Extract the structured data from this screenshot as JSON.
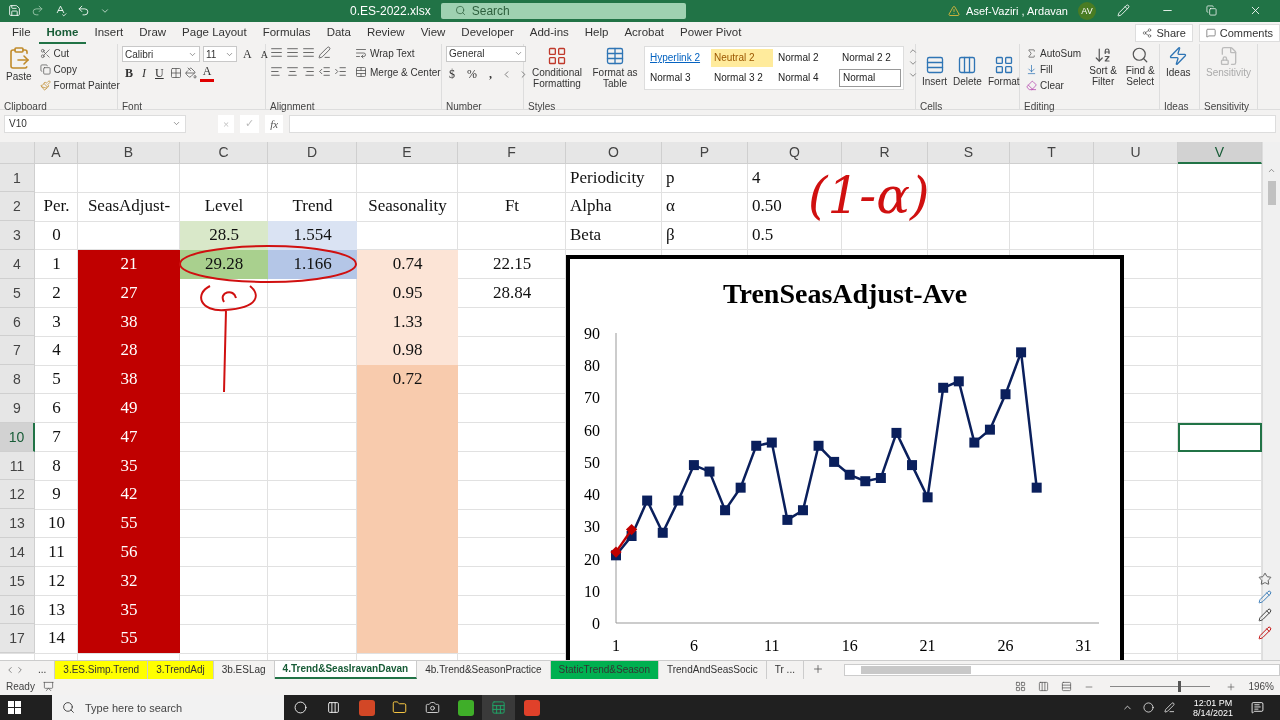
{
  "title_bar": {
    "file_name": "0.ES-2022.xlsx",
    "search": {
      "placeholder": "Search"
    },
    "user": "Asef-Vaziri , Ardavan",
    "avatar": "AV"
  },
  "menu_tabs": [
    {
      "label": "File",
      "selected": false
    },
    {
      "label": "Home",
      "selected": true
    },
    {
      "label": "Insert",
      "selected": false
    },
    {
      "label": "Draw",
      "selected": false
    },
    {
      "label": "Page Layout",
      "selected": false
    },
    {
      "label": "Formulas",
      "selected": false
    },
    {
      "label": "Data",
      "selected": false
    },
    {
      "label": "Review",
      "selected": false
    },
    {
      "label": "View",
      "selected": false
    },
    {
      "label": "Developer",
      "selected": false
    },
    {
      "label": "Add-ins",
      "selected": false
    },
    {
      "label": "Help",
      "selected": false
    },
    {
      "label": "Acrobat",
      "selected": false
    },
    {
      "label": "Power Pivot",
      "selected": false
    }
  ],
  "share": "Share",
  "comments": "Comments",
  "ribbon": [
    {
      "kind": "clipboard",
      "label": "Clipboard",
      "paste": "Paste",
      "cut": "Cut",
      "copy": "Copy",
      "format_painter": "Format Painter"
    },
    {
      "kind": "font",
      "label": "Font",
      "font_name": "Calibri",
      "font_size": "11",
      "grow": "A",
      "shrink": "A",
      "bold": "B",
      "italic": "I",
      "underline": "U",
      "font_color": "A"
    },
    {
      "kind": "alignment",
      "label": "Alignment",
      "wrap_text": "Wrap Text",
      "merge": "Merge & Center"
    },
    {
      "kind": "number",
      "label": "Number",
      "format": "General",
      "currency": "$",
      "percent": "%",
      "comma": ","
    },
    {
      "kind": "styles",
      "label": "Styles",
      "conditional": "Conditional Formatting",
      "format_table": "Format as Table",
      "cell_styles": [
        {
          "label": "Hyperlink 2",
          "kind": "hyperlink",
          "selected": false
        },
        {
          "label": "Neutral 2",
          "kind": "neutral",
          "selected": false
        },
        {
          "label": "Normal 2",
          "kind": "normal",
          "selected": false
        },
        {
          "label": "Normal 2 2",
          "kind": "normal",
          "selected": false
        },
        {
          "label": "Normal 3",
          "kind": "normal",
          "selected": false
        },
        {
          "label": "Normal 3 2",
          "kind": "normal",
          "selected": false
        },
        {
          "label": "Normal 4",
          "kind": "normal",
          "selected": false
        },
        {
          "label": "Normal",
          "kind": "normal",
          "selected": true
        }
      ]
    },
    {
      "kind": "cells",
      "label": "Cells",
      "buttons": [
        "Insert",
        "Delete",
        "Format"
      ]
    },
    {
      "kind": "editing",
      "label": "Editing",
      "autosum": "AutoSum",
      "fill": "Fill",
      "clear": "Clear",
      "sort": "Sort & Filter",
      "find": "Find & Select"
    },
    {
      "kind": "ideas",
      "label": "Ideas",
      "button": "Ideas"
    },
    {
      "kind": "sensitivity",
      "label": "Sensitivity",
      "button": "Sensitivity",
      "disabled": true
    }
  ],
  "formula_bar": {
    "name_box": "V10",
    "cancel": "×",
    "enter": "✓",
    "function": "fx"
  },
  "columns": [
    {
      "label": "A",
      "selected": false
    },
    {
      "label": "B",
      "selected": false
    },
    {
      "label": "C",
      "selected": false
    },
    {
      "label": "D",
      "selected": false
    },
    {
      "label": "E",
      "selected": false
    },
    {
      "label": "F",
      "selected": false
    },
    {
      "label": "O",
      "selected": false
    },
    {
      "label": "P",
      "selected": false
    },
    {
      "label": "Q",
      "selected": false
    },
    {
      "label": "R",
      "selected": false
    },
    {
      "label": "S",
      "selected": false
    },
    {
      "label": "T",
      "selected": false
    },
    {
      "label": "U",
      "selected": false
    },
    {
      "label": "V",
      "selected": true
    }
  ],
  "rows": [
    {
      "header": "1",
      "selected": false,
      "cells": [
        null,
        null,
        null,
        null,
        null,
        null,
        {
          "text": "Periodicity"
        },
        {
          "text": "p"
        },
        {
          "text": "4"
        },
        null,
        null,
        null,
        null,
        null
      ]
    },
    {
      "header": "2",
      "selected": false,
      "cells": [
        {
          "text": "Per."
        },
        {
          "text": "SeasAdjust-"
        },
        {
          "text": "Level"
        },
        {
          "text": "Trend"
        },
        {
          "text": "Seasonality"
        },
        {
          "text": "Ft"
        },
        {
          "text": "Alpha"
        },
        {
          "text": "α"
        },
        {
          "text": "0.50"
        },
        null,
        null,
        null,
        null,
        null
      ]
    },
    {
      "header": "3",
      "selected": false,
      "cells": [
        {
          "text": "0"
        },
        null,
        {
          "text": "28.5",
          "color": "#d9e8c9"
        },
        {
          "text": "1.554",
          "color": "#dae3f3"
        },
        null,
        null,
        {
          "text": "Beta"
        },
        {
          "text": "β"
        },
        {
          "text": "0.5"
        },
        null,
        null,
        null,
        null,
        null
      ]
    },
    {
      "header": "4",
      "selected": false,
      "cells": [
        {
          "text": "1"
        },
        {
          "text": "21",
          "color": "#c00000"
        },
        {
          "text": "29.28",
          "color": "#a9d08e"
        },
        {
          "text": "1.166",
          "color": "#b4c6e7"
        },
        {
          "text": "0.74",
          "color": "#fce4d6"
        },
        {
          "text": "22.15"
        },
        null,
        null,
        null,
        null,
        null,
        null,
        null,
        null
      ]
    },
    {
      "header": "5",
      "selected": false,
      "cells": [
        {
          "text": "2"
        },
        {
          "text": "27",
          "color": "#c00000"
        },
        null,
        null,
        {
          "text": "0.95",
          "color": "#fce4d6"
        },
        {
          "text": "28.84"
        },
        null,
        null,
        null,
        null,
        null,
        null,
        null,
        null
      ]
    },
    {
      "header": "6",
      "selected": false,
      "cells": [
        {
          "text": "3"
        },
        {
          "text": "38",
          "color": "#c00000"
        },
        null,
        null,
        {
          "text": "1.33",
          "color": "#fce4d6"
        },
        null,
        null,
        null,
        null,
        null,
        null,
        null,
        null,
        null
      ]
    },
    {
      "header": "7",
      "selected": false,
      "cells": [
        {
          "text": "4"
        },
        {
          "text": "28",
          "color": "#c00000"
        },
        null,
        null,
        {
          "text": "0.98",
          "color": "#fce4d6"
        },
        null,
        null,
        null,
        null,
        null,
        null,
        null,
        null,
        null
      ]
    },
    {
      "header": "8",
      "selected": false,
      "cells": [
        {
          "text": "5"
        },
        {
          "text": "38",
          "color": "#c00000"
        },
        null,
        null,
        {
          "text": "0.72",
          "color": "#f8cbad"
        },
        null,
        null,
        null,
        null,
        null,
        null,
        null,
        null,
        null
      ]
    },
    {
      "header": "9",
      "selected": false,
      "cells": [
        {
          "text": "6"
        },
        {
          "text": "49",
          "color": "#c00000"
        },
        null,
        null,
        {
          "color": "#f8cbad"
        },
        null,
        null,
        null,
        null,
        null,
        null,
        null,
        null,
        null
      ]
    },
    {
      "header": "10",
      "selected": true,
      "cells": [
        {
          "text": "7"
        },
        {
          "text": "47",
          "color": "#c00000"
        },
        null,
        null,
        {
          "color": "#f8cbad"
        },
        null,
        null,
        null,
        null,
        null,
        null,
        null,
        null,
        null
      ]
    },
    {
      "header": "11",
      "selected": false,
      "cells": [
        {
          "text": "8"
        },
        {
          "text": "35",
          "color": "#c00000"
        },
        null,
        null,
        {
          "color": "#f8cbad"
        },
        null,
        null,
        null,
        null,
        null,
        null,
        null,
        null,
        null
      ]
    },
    {
      "header": "12",
      "selected": false,
      "cells": [
        {
          "text": "9"
        },
        {
          "text": "42",
          "color": "#c00000"
        },
        null,
        null,
        {
          "color": "#f8cbad"
        },
        null,
        null,
        null,
        null,
        null,
        null,
        null,
        null,
        null
      ]
    },
    {
      "header": "13",
      "selected": false,
      "cells": [
        {
          "text": "10"
        },
        {
          "text": "55",
          "color": "#c00000"
        },
        null,
        null,
        {
          "color": "#f8cbad"
        },
        null,
        null,
        null,
        null,
        null,
        null,
        null,
        null,
        null
      ]
    },
    {
      "header": "14",
      "selected": false,
      "cells": [
        {
          "text": "11"
        },
        {
          "text": "56",
          "color": "#c00000"
        },
        null,
        null,
        {
          "color": "#f8cbad"
        },
        null,
        null,
        null,
        null,
        null,
        null,
        null,
        null,
        null
      ]
    },
    {
      "header": "15",
      "selected": false,
      "cells": [
        {
          "text": "12"
        },
        {
          "text": "32",
          "color": "#c00000"
        },
        null,
        null,
        {
          "color": "#f8cbad"
        },
        null,
        null,
        null,
        null,
        null,
        null,
        null,
        null,
        null
      ]
    },
    {
      "header": "16",
      "selected": false,
      "cells": [
        {
          "text": "13"
        },
        {
          "text": "35",
          "color": "#c00000"
        },
        null,
        null,
        {
          "color": "#f8cbad"
        },
        null,
        null,
        null,
        null,
        null,
        null,
        null,
        null,
        null
      ]
    },
    {
      "header": "17",
      "selected": false,
      "cells": [
        {
          "text": "14"
        },
        {
          "text": "55",
          "color": "#c00000"
        },
        null,
        null,
        {
          "color": "#f8cbad"
        },
        null,
        null,
        null,
        null,
        null,
        null,
        null,
        null,
        null
      ]
    }
  ],
  "annotation": "(1-α)",
  "chart": {
    "chart_data": {
      "type": "line",
      "title": "TrenSeasAdjust-Ave",
      "x": [
        1,
        2,
        3,
        4,
        5,
        6,
        7,
        8,
        9,
        10,
        11,
        12,
        13,
        14,
        15,
        16,
        17,
        18,
        19,
        20,
        21,
        22,
        23,
        24,
        25,
        26,
        27,
        28
      ],
      "series": [
        {
          "color": "#0a1f5c",
          "marker": "square",
          "values": [
            21,
            27,
            38,
            28,
            38,
            49,
            47,
            35,
            42,
            55,
            56,
            32,
            35,
            55,
            50,
            46,
            44,
            45,
            59,
            49,
            39,
            73,
            75,
            56,
            60,
            71,
            84,
            42
          ]
        },
        {
          "color": "#c00000",
          "marker": "diamond",
          "values": [
            22,
            29,
            null,
            null,
            null,
            null,
            null,
            null,
            null,
            null,
            null,
            null,
            null,
            null,
            null,
            null,
            null,
            null,
            null,
            null,
            null,
            null,
            null,
            null,
            null,
            null,
            null,
            null
          ]
        }
      ],
      "xlim": [
        1,
        32
      ],
      "ylim": [
        0,
        90
      ],
      "xticks": [
        1,
        6,
        11,
        16,
        21,
        26,
        31
      ],
      "yticks": [
        0,
        10,
        20,
        30,
        40,
        50,
        60,
        70,
        80,
        90
      ]
    }
  },
  "sheet_tabs": [
    {
      "label": "...",
      "selected": false
    },
    {
      "label": "3.ES.Simp.Trend",
      "selected": false,
      "color": "#ffff00"
    },
    {
      "label": "3.TrendAdj",
      "selected": false,
      "color": "#ffff00"
    },
    {
      "label": "3b.ESLag",
      "selected": false
    },
    {
      "label": "4.Trend&SeasIravanDavan",
      "selected": true
    },
    {
      "label": "4b.Trend&SeasonPractice",
      "selected": false
    },
    {
      "label": "StaticTrend&Season",
      "selected": false,
      "color": "#00b050"
    },
    {
      "label": "TrendAndSeasSocic",
      "selected": false
    },
    {
      "label": "Tr ...",
      "selected": false
    }
  ],
  "status_bar": {
    "status": "Ready",
    "zoom": {
      "level": 0.68,
      "reading": "196%"
    }
  },
  "taskbar": {
    "search": {
      "placeholder": "Type here to search"
    },
    "time": "12:01 PM",
    "date": "8/14/2021"
  }
}
